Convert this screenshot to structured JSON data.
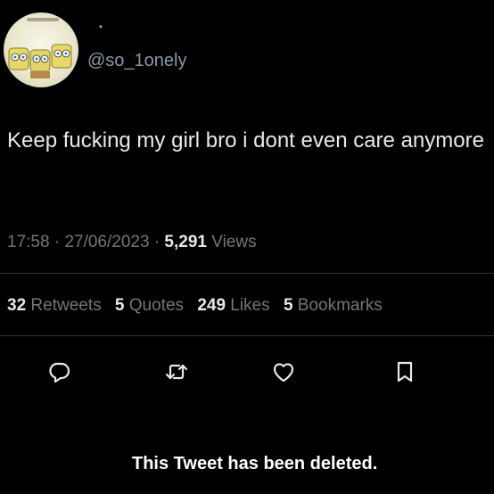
{
  "author": {
    "handle": "@so_1onely",
    "verified_mark": "*",
    "avatar_icon": "cartoon-avatar-icon"
  },
  "tweet": {
    "text": "Keep fucking my girl bro i dont even care anymore",
    "time": "17:58",
    "separator": "·",
    "date": "27/06/2023",
    "views_count": "5,291",
    "views_label": "Views"
  },
  "stats": {
    "retweets_count": "32",
    "retweets_label": "Retweets",
    "quotes_count": "5",
    "quotes_label": "Quotes",
    "likes_count": "249",
    "likes_label": "Likes",
    "bookmarks_count": "5",
    "bookmarks_label": "Bookmarks"
  },
  "actions": [
    {
      "icon": "reply-icon"
    },
    {
      "icon": "retweet-icon"
    },
    {
      "icon": "like-icon"
    },
    {
      "icon": "bookmark-icon"
    }
  ],
  "notice": "This Tweet has been deleted.",
  "colors": {
    "background": "#000000",
    "text": "#e7e9ea",
    "secondary": "#71767b",
    "divider": "#2f3336"
  }
}
